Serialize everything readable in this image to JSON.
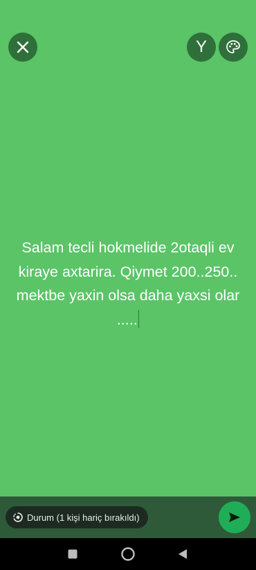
{
  "toolbar": {
    "close_icon": "close-icon",
    "font_label": "Y",
    "palette_icon": "palette-icon"
  },
  "status": {
    "text": "Salam tecli hokmelide 2otaqli ev kiraye axtarira. Qiymet 200..250.. mektbe yaxin olsa daha yaxsi olar .....",
    "background_color": "#5ac467",
    "text_color": "#ffffff"
  },
  "composer": {
    "audience_label": "Durum (1 kişi hariç bırakıldı)",
    "audience_icon": "status-ring-icon",
    "send_icon": "send-icon",
    "send_color": "#1fae57"
  },
  "navigation": {
    "recents_icon": "recents-square-icon",
    "home_icon": "home-circle-icon",
    "back_icon": "back-triangle-icon"
  }
}
